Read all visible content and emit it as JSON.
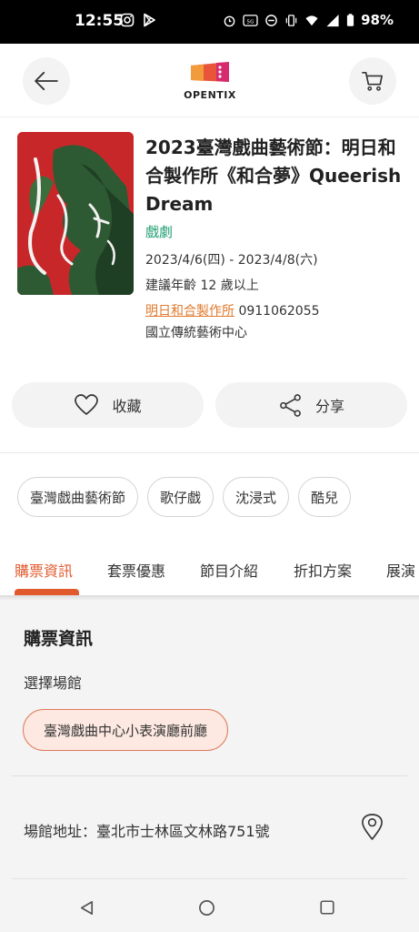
{
  "status_bar": {
    "time": "12:55",
    "battery": "98%",
    "left_icons": [
      "instagram-icon",
      "play-store-icon"
    ],
    "right_icons": [
      "alarm-icon",
      "nfc-icon",
      "dnd-icon",
      "vibrate-icon",
      "wifi-icon",
      "signal-icon",
      "battery-icon"
    ]
  },
  "header": {
    "logo_text": "OPENTIX",
    "back_icon": "arrow-left-icon",
    "cart_icon": "cart-icon"
  },
  "event": {
    "title": "2023臺灣戲曲藝術節：明日和合製作所《和合夢》Queerish Dream",
    "category": "戲劇",
    "dates": "2023/4/6(四) - 2023/4/8(六)",
    "age": "建議年齡  12 歲以上",
    "organizer": "明日和合製作所",
    "phone": "0911062055",
    "venue": "國立傳統藝術中心"
  },
  "actions": {
    "favorite_label": "收藏",
    "share_label": "分享"
  },
  "tags": [
    "臺灣戲曲藝術節",
    "歌仔戲",
    "沈浸式",
    "酷兒"
  ],
  "tabs": [
    {
      "label": "購票資訊",
      "active": true
    },
    {
      "label": "套票優惠",
      "active": false
    },
    {
      "label": "節目介紹",
      "active": false
    },
    {
      "label": "折扣方案",
      "active": false
    },
    {
      "label": "展演",
      "active": false
    }
  ],
  "ticket_info": {
    "title": "購票資訊",
    "select_venue_label": "選擇場館",
    "selected_venue": "臺灣戲曲中心小表演廳前廳",
    "address": "場館地址：臺北市士林區文林路751號"
  },
  "colors": {
    "accent": "#e05a2e",
    "category_green": "#1f9e71",
    "organizer_orange": "#e07a2e",
    "poster_red": "#c8272a"
  }
}
